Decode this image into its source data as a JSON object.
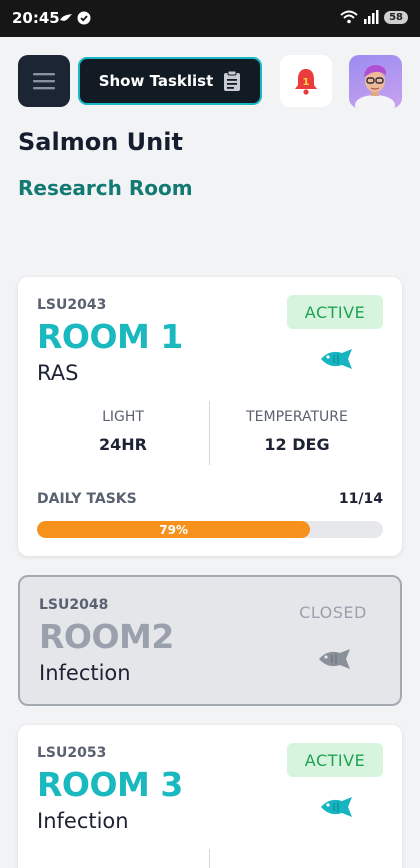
{
  "status_bar": {
    "time": "20:45",
    "battery": "58"
  },
  "header": {
    "tasklist_button_label": "Show Tasklist",
    "notification_badge": "1"
  },
  "page": {
    "title": "Salmon Unit",
    "subtitle": "Research Room"
  },
  "colors": {
    "active_room": "#1ab9bf",
    "active_status": "#1fa252",
    "progress": "#f6911e",
    "subtitle": "#127a72"
  },
  "rooms": [
    {
      "code": "LSU2043",
      "name": "ROOM 1",
      "type": "RAS",
      "status": "ACTIVE",
      "icon": "fish-icon",
      "light_label": "LIGHT",
      "light_value": "24HR",
      "temperature_label": "TEMPERATURE",
      "temperature_value": "12 DEG",
      "tasks_label": "DAILY TASKS",
      "tasks_count": "11/14",
      "progress_percent": 79,
      "progress_text": "79%"
    },
    {
      "code": "LSU2048",
      "name": "ROOM2",
      "type": "Infection",
      "status": "CLOSED",
      "icon": "fish-icon"
    },
    {
      "code": "LSU2053",
      "name": "ROOM 3",
      "type": "Infection",
      "status": "ACTIVE",
      "icon": "fish-icon"
    }
  ]
}
